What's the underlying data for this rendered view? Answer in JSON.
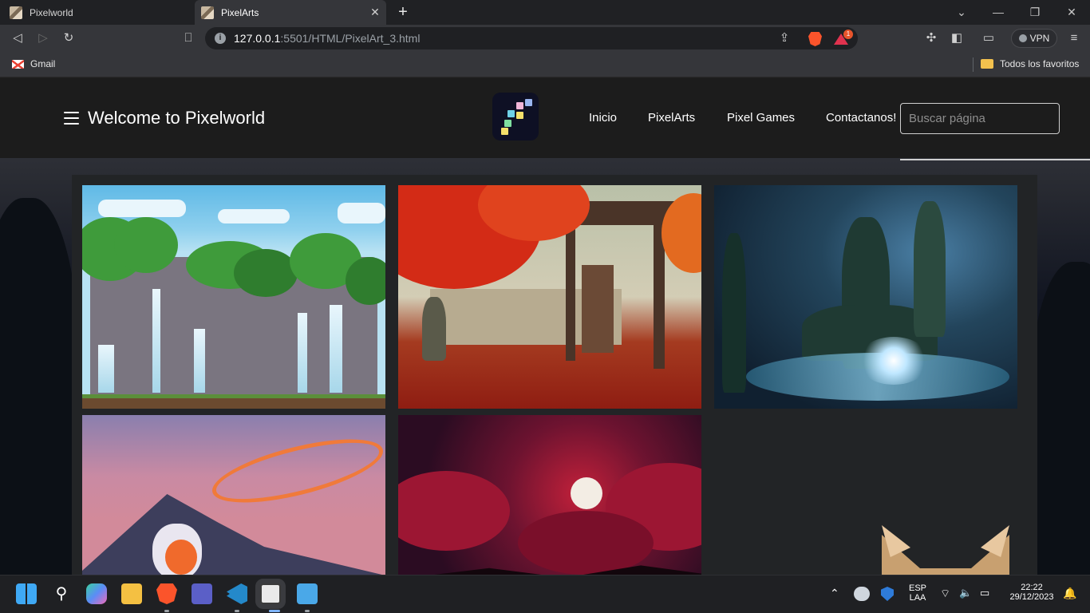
{
  "browser": {
    "tabs": [
      {
        "title": "Pixelworld",
        "active": false
      },
      {
        "title": "PixelArts",
        "active": true
      }
    ],
    "url": {
      "host": "127.0.0.1",
      "path": ":5501/HTML/PixelArt_3.html"
    },
    "vpn_label": "VPN",
    "notification_count": "1",
    "bookmarks": [
      {
        "label": "Gmail",
        "icon": "gmail-icon"
      },
      {
        "label": "Todos los favoritos",
        "icon": "folder-icon"
      }
    ]
  },
  "site": {
    "title": "Welcome to Pixelworld",
    "logo_colors": [
      "#f2b6d8",
      "#6fd1e8",
      "#f5e06a",
      "#7fe0a0",
      "#9ab6f0"
    ],
    "nav": [
      {
        "label": "Inicio"
      },
      {
        "label": "PixelArts"
      },
      {
        "label": "Pixel Games"
      },
      {
        "label": "Contactanos!"
      }
    ],
    "search_placeholder": "Buscar página"
  },
  "gallery": {
    "images": [
      {
        "name": "waterfall-cliff-art"
      },
      {
        "name": "autumn-gate-art"
      },
      {
        "name": "mystic-forest-art"
      },
      {
        "name": "astronaut-planet-art"
      },
      {
        "name": "red-clouds-moon-art"
      },
      {
        "name": "cat-art"
      }
    ]
  },
  "taskbar": {
    "apps": [
      "windows-start-icon",
      "search-icon",
      "copilot-icon",
      "file-explorer-icon",
      "brave-icon",
      "teams-icon",
      "vscode-icon",
      "snipping-tool-icon",
      "notepad-icon"
    ],
    "language": "ESP",
    "keyboard": "LAA",
    "time": "22:22",
    "date": "29/12/2023"
  },
  "colors": {
    "accent_red": "#fb542b",
    "header_bg": "#1c1c1c",
    "panel_bg": "#222426"
  }
}
